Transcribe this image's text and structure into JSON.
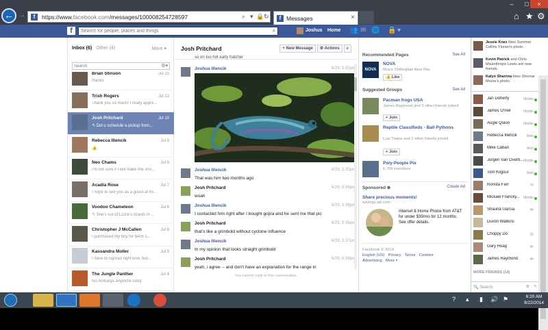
{
  "browser": {
    "url_prefix": "https://www.",
    "url_domain": "facebook.com",
    "url_path": "/messages/100008254728597",
    "tab_title": "Messages"
  },
  "fb": {
    "search_placeholder": "Search for people, places and things",
    "user_name": "Joshus",
    "home_label": "Home"
  },
  "inbox": {
    "inbox_label": "Inbox (6)",
    "other_label": "Other (4)",
    "more_label": "More",
    "search_placeholder": "Search",
    "threads": [
      {
        "name": "Brian Stinson",
        "snippet": "thanks",
        "date": "Jul 15"
      },
      {
        "name": "Trish Rogers",
        "snippet": "Thank you so much! I really appre...",
        "date": "Jul 12"
      },
      {
        "name": "Josh Pritchard",
        "snippet": "↰ Did u schedule a pickup from...",
        "date": "Jul 10"
      },
      {
        "name": "Rebecca Illencik",
        "snippet": "👍",
        "date": "Jul 9"
      },
      {
        "name": "Neo Chams",
        "snippet": "I'm not sure if I will make the sho...",
        "date": "Jul 9"
      },
      {
        "name": "Acadia Rose",
        "snippet": "I hope to see you as a guest at thi...",
        "date": "Jul 7"
      },
      {
        "name": "Voodoo Chameleon",
        "snippet": "↰ She's out of Lizzie's lizards in ...",
        "date": "Jul 6"
      },
      {
        "name": "Christopher J McCallen",
        "snippet": "I purchased my boy for $405 s...",
        "date": "Jul 6"
      },
      {
        "name": "Kassandra Moller",
        "snippet": "I have to signout right now, but...",
        "date": "Jul 5"
      },
      {
        "name": "The Jungle Panther",
        "snippet": "No Ambanja anymore sorry",
        "date": "Jul 4"
      }
    ]
  },
  "conversation": {
    "title": "Josh Pritchard",
    "new_message": "+ New Message",
    "actions": "⚙ Actions",
    "top_snippet": "so on too hot early hatcher",
    "cannot_reply": "You cannot reply to this conversation.",
    "messages": [
      {
        "name": "Joshua Illencik",
        "time": "6/29, 5:35pm",
        "text": "",
        "blue": true
      },
      {
        "name": "Joshua Illencik",
        "time": "6/29, 5:35pm",
        "text": "That was him two months ago",
        "blue": true
      },
      {
        "name": "Josh Pritchard",
        "time": "6/29, 5:36pm",
        "text": "woah",
        "blue": false
      },
      {
        "name": "Joshua Illencik",
        "time": "6/29, 5:36pm",
        "text": "I contacted him right after I bought gojira and he sent me that pic",
        "blue": true
      },
      {
        "name": "Josh Pritchard",
        "time": "6/29, 5:36pm",
        "text": "that's like a grimbold without cyclone influence",
        "blue": false
      },
      {
        "name": "Joshua Illencik",
        "time": "6/29, 5:37pm",
        "text": "In my opinion that looks straight grimbold",
        "blue": true
      },
      {
        "name": "Josh Pritchard",
        "time": "6/29, 5:38pm",
        "text": "yeah, i agree -- and don't have an explanation for the range in",
        "blue": false
      }
    ]
  },
  "right": {
    "rec_pages_label": "Recommended Pages",
    "see_all": "See All",
    "page_name": "NOVA",
    "page_sub": "Bruce Shillinglaw likes this.",
    "like_label": "👍 Like",
    "sugg_groups_label": "Suggested Groups",
    "groups": [
      {
        "name": "Pacman frogs USA",
        "sub": "James Raymond and 3 other friends joined"
      },
      {
        "name": "Reptile Classifieds - Ball Pythons",
        "sub": "Luis Triana and 2 other friends joined"
      },
      {
        "name": "Poly-People Pix",
        "sub": "5,799 members"
      }
    ],
    "join_label": "+ Join",
    "sponsored_label": "Sponsored",
    "create_ad": "Create Ad",
    "ad_title": "Share precious moments!",
    "ad_domain": "savings.att.com",
    "ad_text": "Internet & Home Phone from AT&T for under $39/mo for 12 months. See offer details.",
    "footer_copy": "Facebook © 2014",
    "footer_lang": "English (US)",
    "footer_links": [
      "Privacy",
      "Terms",
      "Cookies",
      "Advertising",
      "More"
    ]
  },
  "chat": {
    "ticker": [
      {
        "name": "Jessie Knez",
        "text": "likes Summer Collins Ylonen's photo."
      },
      {
        "name": "Kevin Patrick",
        "text": "and Chris Misanthrope Lewis are now friends."
      },
      {
        "name": "Kalyn Sharrow",
        "text": "likes Shemar Moore's photo."
      }
    ],
    "friends": [
      {
        "name": "Jan Doherty",
        "status": "Mobile",
        "online": true
      },
      {
        "name": "James O'neil",
        "status": "Mobile",
        "online": true
      },
      {
        "name": "Augie Quion",
        "status": "Mobile",
        "online": true
      },
      {
        "name": "Rebecca Illencik",
        "status": "Web",
        "online": true
      },
      {
        "name": "Mike Caban",
        "status": "Web",
        "online": true
      },
      {
        "name": "Jurgen Van Overb...",
        "status": "Mobile",
        "online": true
      },
      {
        "name": "Tom Kilgour",
        "status": "Web",
        "online": true
      },
      {
        "name": "Ronsta Farr",
        "status": "7h",
        "online": false
      },
      {
        "name": "Mickael Francky...",
        "status": "Mobile",
        "online": true
      },
      {
        "name": "Shauna Garcia",
        "status": "4h",
        "online": false
      },
      {
        "name": "Dustin Watkins",
        "status": "",
        "online": false
      },
      {
        "name": "Choppy Do",
        "status": "2h",
        "online": false
      },
      {
        "name": "Gary Hoag",
        "status": "9h",
        "online": false
      },
      {
        "name": "James Raymond",
        "status": "4h",
        "online": false
      }
    ],
    "more_friends": "MORE FRIENDS (14)",
    "search_label": "🔍 Search"
  },
  "taskbar": {
    "time": "6:20 AM",
    "date": "8/22/2014"
  }
}
